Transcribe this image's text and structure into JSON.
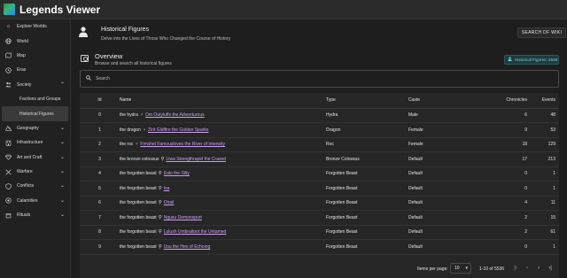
{
  "app": {
    "title": "Legends Viewer"
  },
  "sidebar": {
    "items": [
      {
        "label": "Explore Worlds",
        "icon": "home-icon"
      },
      {
        "label": "World",
        "icon": "globe-icon"
      },
      {
        "label": "Map",
        "icon": "map-icon"
      },
      {
        "label": "Eras",
        "icon": "clock-icon"
      },
      {
        "label": "Society",
        "icon": "people-icon",
        "expanded": true
      },
      {
        "label": "Factions and Groups",
        "sub": true
      },
      {
        "label": "Historical Figures",
        "sub": true,
        "active": true
      },
      {
        "label": "Geography",
        "icon": "mountain-icon"
      },
      {
        "label": "Infrastructure",
        "icon": "building-icon"
      },
      {
        "label": "Art and Craft",
        "icon": "gem-icon"
      },
      {
        "label": "Warfare",
        "icon": "swords-icon"
      },
      {
        "label": "Conflicts",
        "icon": "shield-icon"
      },
      {
        "label": "Calamities",
        "icon": "calamity-icon"
      },
      {
        "label": "Rituals",
        "icon": "ritual-icon"
      }
    ]
  },
  "header": {
    "title": "Historical Figures",
    "subtitle": "Delve into the Lives of Those Who Changed the Course of History",
    "wiki_button": "SEARCH DF WIKI"
  },
  "overview": {
    "title": "Overview",
    "subtitle": "Browse and search all historical figures",
    "badge": "Historical Figures: 5536"
  },
  "search": {
    "placeholder": "Search"
  },
  "table": {
    "headers": {
      "id": "Id",
      "name": "Name",
      "type": "Type",
      "caste": "Caste",
      "chronicles": "Chronicles",
      "events": "Events"
    },
    "rows": [
      {
        "id": "0",
        "race": "the hydra",
        "gender": "♂",
        "name": "Om Outyluffs the Adventurous",
        "type": "Hydra",
        "caste": "Male",
        "chronicles": "6",
        "events": "48"
      },
      {
        "id": "1",
        "race": "the dragon",
        "gender": "♀",
        "name": "Zirit Glidfire the Golden Sparks",
        "type": "Dragon",
        "caste": "Female",
        "chronicles": "9",
        "events": "53"
      },
      {
        "id": "2",
        "race": "the roc",
        "gender": "♀",
        "name": "Fimshel Famousloves the River of Intensity",
        "type": "Roc",
        "caste": "Female",
        "chronicles": "18",
        "events": "129"
      },
      {
        "id": "3",
        "race": "the bronze colossus",
        "gender": "⚲",
        "name": "Liwa Strengthrapid the Crazed",
        "type": "Bronze Colossus",
        "caste": "Default",
        "chronicles": "17",
        "events": "213"
      },
      {
        "id": "4",
        "race": "the forgotten beast",
        "gender": "⚲",
        "name": "Ealo the Silty",
        "type": "Forgotten Beast",
        "caste": "Default",
        "chronicles": "0",
        "events": "1"
      },
      {
        "id": "5",
        "race": "the forgotten beast",
        "gender": "⚲",
        "name": "Isa",
        "type": "Forgotten Beast",
        "caste": "Default",
        "chronicles": "0",
        "events": "1"
      },
      {
        "id": "6",
        "race": "the forgotten beast",
        "gender": "⚲",
        "name": "Oirail",
        "type": "Forgotten Beast",
        "caste": "Default",
        "chronicles": "4",
        "events": "11"
      },
      {
        "id": "7",
        "race": "the forgotten beast",
        "gender": "⚲",
        "name": "Ngusu Demonspurt",
        "type": "Forgotten Beast",
        "caste": "Default",
        "chronicles": "2",
        "events": "15"
      },
      {
        "id": "8",
        "race": "the forgotten beast",
        "gender": "⚲",
        "name": "Lulush Umbraltoot the Untamed",
        "type": "Forgotten Beast",
        "caste": "Default",
        "chronicles": "2",
        "events": "61"
      },
      {
        "id": "9",
        "race": "the forgotten beast",
        "gender": "⚲",
        "name": "Usu the Hex of Echoing",
        "type": "Forgotten Beast",
        "caste": "Default",
        "chronicles": "0",
        "events": "1"
      }
    ]
  },
  "pager": {
    "items_per_page_label": "Items per page:",
    "items_per_page": "10",
    "range": "1-10 of 5536"
  }
}
